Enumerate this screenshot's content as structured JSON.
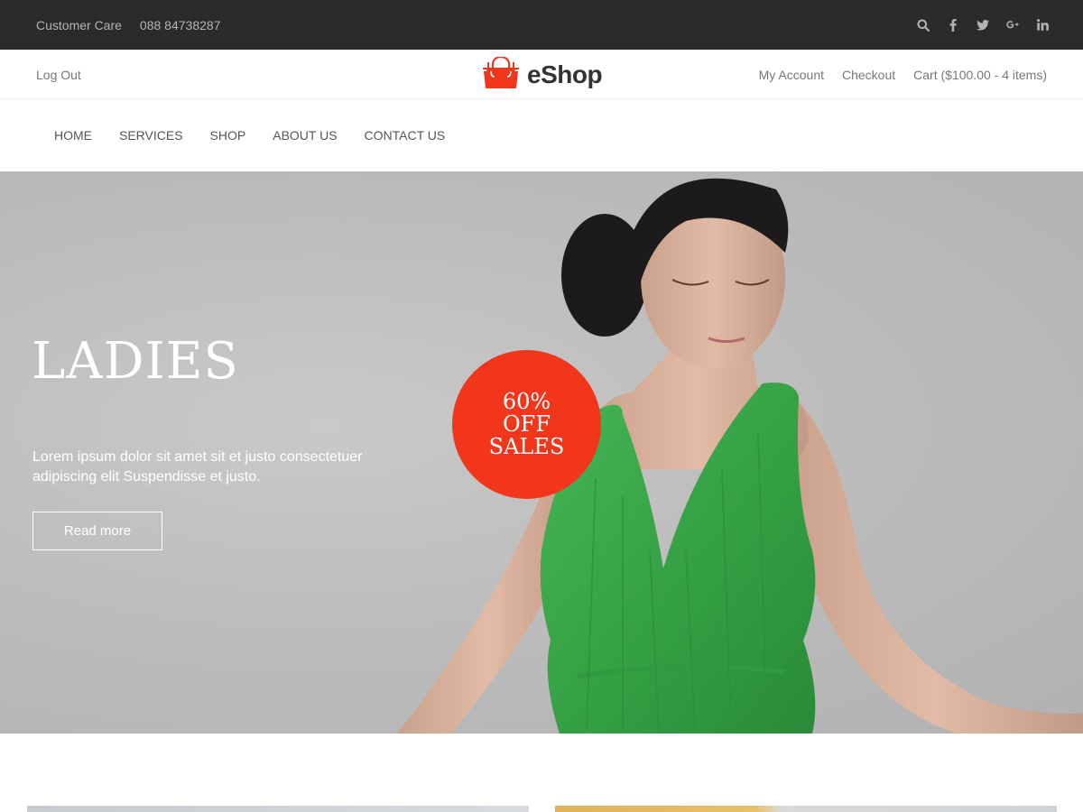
{
  "topbar": {
    "customer_care_label": "Customer Care",
    "phone": "088 84738287",
    "icons": [
      "search-icon",
      "facebook-icon",
      "twitter-icon",
      "google-plus-icon",
      "linkedin-icon"
    ]
  },
  "header": {
    "logout_label": "Log Out",
    "logo_text": "eShop",
    "my_account_label": "My Account",
    "checkout_label": "Checkout",
    "cart_label": "Cart ($100.00 - 4 items)"
  },
  "nav": {
    "items": [
      {
        "label": "HOME"
      },
      {
        "label": "SERVICES"
      },
      {
        "label": "SHOP"
      },
      {
        "label": "ABOUT US"
      },
      {
        "label": "CONTACT US"
      }
    ]
  },
  "hero": {
    "title": "LADIES",
    "description": "Lorem ipsum dolor sit amet sit et justo consectetuer adipiscing elit Suspendisse et justo.",
    "button_label": "Read more",
    "badge": {
      "line1": "60%",
      "line2": "OFF",
      "line3": "SALES"
    }
  },
  "colors": {
    "topbar_bg": "#2b2b2b",
    "accent": "#f1361b",
    "dress": "#3aa84a"
  }
}
